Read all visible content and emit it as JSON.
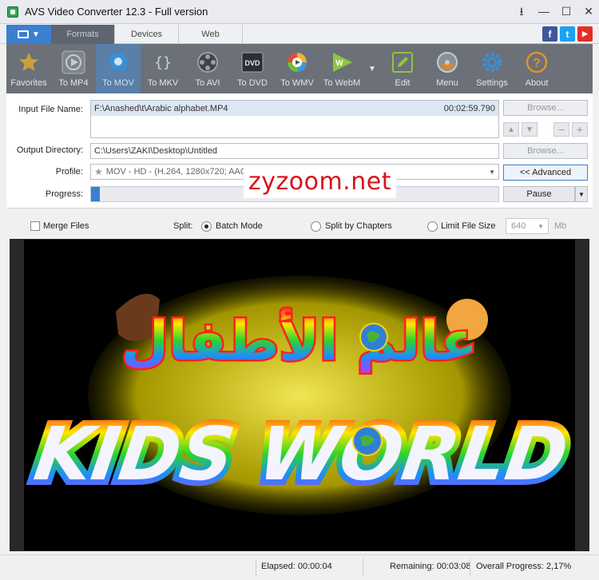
{
  "window": {
    "title": "AVS Video Converter 12.3 - Full version",
    "controls": [
      "⭳",
      "—",
      "☐",
      "✕"
    ]
  },
  "tabs": [
    {
      "label": "Formats",
      "active": true
    },
    {
      "label": "Devices",
      "active": false
    },
    {
      "label": "Web",
      "active": false
    }
  ],
  "social": [
    {
      "icon": "facebook-icon",
      "glyph": "f",
      "color": "#3b5998"
    },
    {
      "icon": "twitter-icon",
      "glyph": "t",
      "color": "#1da1f2"
    },
    {
      "icon": "youtube-icon",
      "glyph": "▶",
      "color": "#e52d27"
    }
  ],
  "toolbar": {
    "items": [
      {
        "label": "Favorites",
        "icon": "star-icon"
      },
      {
        "label": "To MP4",
        "icon": "mp4-icon"
      },
      {
        "label": "To MOV",
        "icon": "mov-icon",
        "active": true
      },
      {
        "label": "To MKV",
        "icon": "mkv-icon"
      },
      {
        "label": "To AVI",
        "icon": "avi-reel-icon"
      },
      {
        "label": "To DVD",
        "icon": "dvd-icon"
      },
      {
        "label": "To WMV",
        "icon": "wmv-icon"
      },
      {
        "label": "To WebM",
        "icon": "webm-icon"
      }
    ],
    "more_glyph": "▼",
    "right_items": [
      {
        "label": "Edit",
        "icon": "edit-icon"
      },
      {
        "label": "Menu",
        "icon": "menu-disc-icon"
      },
      {
        "label": "Settings",
        "icon": "gear-icon"
      },
      {
        "label": "About",
        "icon": "help-icon"
      }
    ]
  },
  "form": {
    "input_label": "Input File Name:",
    "input_file": "F:\\Anashed\\t\\Arabic alphabet.MP4",
    "input_duration": "00:02:59.790",
    "output_label": "Output Directory:",
    "output_dir": "C:\\Users\\ZAKI\\Desktop\\Untitled",
    "profile_label": "Profile:",
    "profile_value": "MOV - HD - (H.264, 1280x720; AAC, 256 kbps)",
    "progress_label": "Progress:",
    "progress_fraction": 0.0217,
    "browse_label": "Browse...",
    "advanced_label": "<< Advanced",
    "pause_label": "Pause"
  },
  "watermark": "zyzoom.net",
  "options": {
    "merge_label": "Merge Files",
    "split_label": "Split:",
    "batch_label": "Batch Mode",
    "chapters_label": "Split by Chapters",
    "limit_label": "Limit File Size",
    "size_value": "640",
    "size_unit": "Mb"
  },
  "preview": {
    "arabic_text": "عالم الأطفال",
    "english_text": "KIDS WORLD"
  },
  "status": {
    "elapsed": "Elapsed: 00:00:04",
    "remaining": "Remaining: 00:03:08",
    "overall": "Overall Progress: 2,17%"
  }
}
